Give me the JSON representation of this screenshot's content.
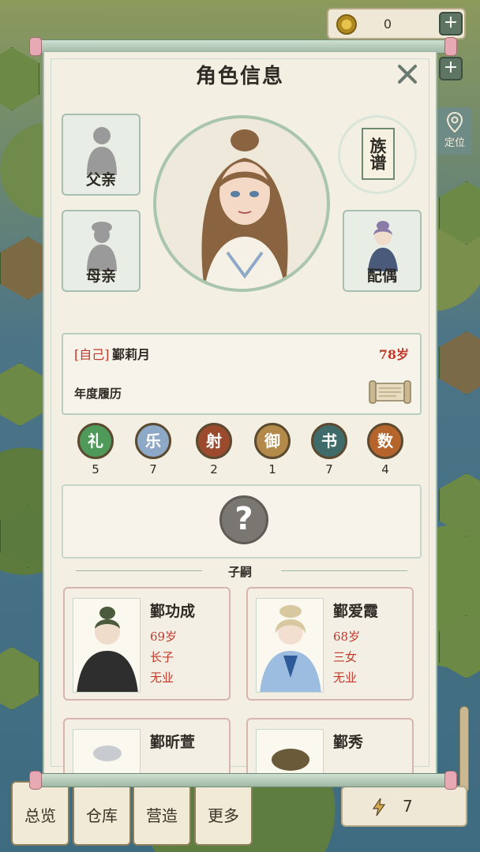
{
  "header": {
    "coins": "0",
    "coin_icon": "coin-icon",
    "plus_label": "+",
    "locate_label": "定位"
  },
  "dialog": {
    "title": "角色信息",
    "close_icon": "close-icon",
    "father_label": "父亲",
    "mother_label": "母亲",
    "spouse_label": "配偶",
    "genealogy_label": "族谱",
    "self_tag": "[自己]",
    "self_name": "鄞莉月",
    "self_age": "78岁",
    "yearly_label": "年度履历",
    "mystery_symbol": "?",
    "children_title": "子嗣"
  },
  "skills": [
    {
      "name": "礼",
      "value": "5",
      "color": "#4f9a5a"
    },
    {
      "name": "乐",
      "value": "7",
      "color": "#8ea8c8"
    },
    {
      "name": "射",
      "value": "2",
      "color": "#9b4a2e"
    },
    {
      "name": "御",
      "value": "1",
      "color": "#b38a4a"
    },
    {
      "name": "书",
      "value": "7",
      "color": "#3f6b6a"
    },
    {
      "name": "数",
      "value": "4",
      "color": "#b5642c"
    }
  ],
  "children": [
    {
      "name": "鄞功成",
      "age": "69岁",
      "rank": "长子",
      "job": "无业"
    },
    {
      "name": "鄞爱霞",
      "age": "68岁",
      "rank": "三女",
      "job": "无业"
    },
    {
      "name": "鄞昕萱"
    },
    {
      "name": "鄞秀"
    }
  ],
  "bottom_nav": [
    {
      "label": "总览"
    },
    {
      "label": "仓库"
    },
    {
      "label": "营造"
    },
    {
      "label": "更多"
    }
  ],
  "energy": {
    "value": "7",
    "icon": "lightning-icon"
  },
  "colors": {
    "accent_red": "#c0392b",
    "frame_green": "#a9bdb0",
    "paper": "#f3efe3"
  }
}
